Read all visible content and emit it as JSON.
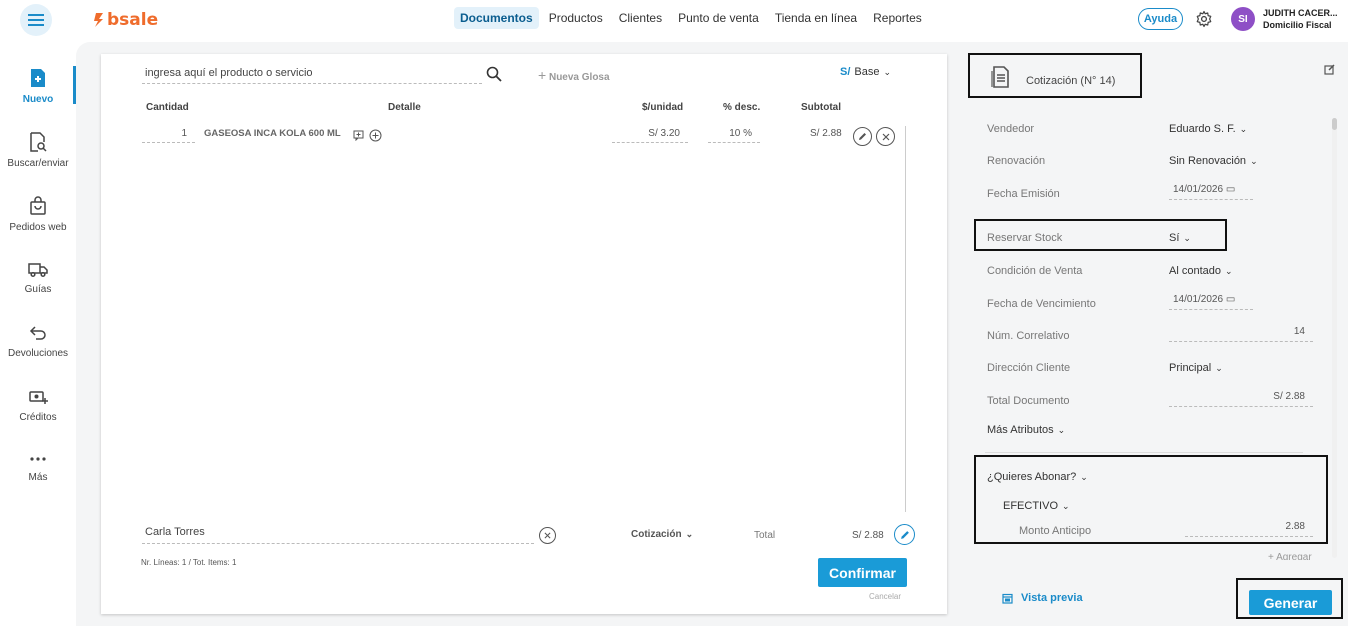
{
  "topbar": {
    "logo_text": "bsale",
    "nav": [
      "Documentos",
      "Productos",
      "Clientes",
      "Punto de venta",
      "Tienda en línea",
      "Reportes"
    ],
    "help_label": "Ayuda",
    "avatar_initials": "SI",
    "user_name": "JUDITH CACER...",
    "user_branch": "Domicilio Fiscal"
  },
  "sidebar": {
    "items": [
      {
        "label": "Nuevo",
        "icon": "new-document-icon"
      },
      {
        "label": "Buscar/enviar",
        "icon": "search-document-icon"
      },
      {
        "label": "Pedidos web",
        "icon": "shopping-bag-icon"
      },
      {
        "label": "Guías",
        "icon": "truck-icon"
      },
      {
        "label": "Devoluciones",
        "icon": "return-arrow-icon"
      },
      {
        "label": "Créditos",
        "icon": "money-plus-icon"
      },
      {
        "label": "Más",
        "icon": "more-dots-icon"
      }
    ]
  },
  "document": {
    "search_placeholder": "ingresa aquí el producto o servicio",
    "nueva_glosa": "Nueva Glosa",
    "currency_symbol": "S/",
    "currency_label": "Base",
    "headers": {
      "cantidad": "Cantidad",
      "detalle": "Detalle",
      "unidad": "$/unidad",
      "desc": "% desc.",
      "subtotal": "Subtotal"
    },
    "rows": [
      {
        "cantidad": "1",
        "detalle": "GASEOSA INCA KOLA 600 ML",
        "unidad": "S/ 3.20",
        "desc": "10 %",
        "subtotal": "S/ 2.88"
      }
    ],
    "client": "Carla Torres",
    "doc_type": "Cotización",
    "total_label": "Total",
    "total_value": "S/ 2.88",
    "lines_info": "Nr. Líneas: 1 / Tot. Items: 1",
    "confirm_label": "Confirmar",
    "cancel_label": "Cancelar"
  },
  "panel": {
    "title": "Cotización (N° 14)",
    "fields": {
      "vendedor": {
        "label": "Vendedor",
        "value": "Eduardo S. F."
      },
      "renovacion": {
        "label": "Renovación",
        "value": "Sin Renovación"
      },
      "fecha_emision": {
        "label": "Fecha Emisión",
        "value": "14/01/2026"
      },
      "reservar_stock": {
        "label": "Reservar Stock",
        "value": "Sí"
      },
      "condicion_venta": {
        "label": "Condición de Venta",
        "value": "Al contado"
      },
      "fecha_vencimiento": {
        "label": "Fecha de Vencimiento",
        "value": "14/01/2026"
      },
      "correlativo": {
        "label": "Núm. Correlativo",
        "value": "14"
      },
      "direccion": {
        "label": "Dirección Cliente",
        "value": "Principal"
      },
      "total_documento": {
        "label": "Total Documento",
        "value": "S/ 2.88"
      }
    },
    "mas_atributos": "Más Atributos",
    "abonar": "¿Quieres Abonar?",
    "efectivo": "EFECTIVO",
    "monto_anticipo_label": "Monto Anticipo",
    "monto_anticipo_value": "2.88",
    "agregar": "+ Agregar",
    "preview_label": "Vista previa",
    "generar_label": "Generar"
  }
}
